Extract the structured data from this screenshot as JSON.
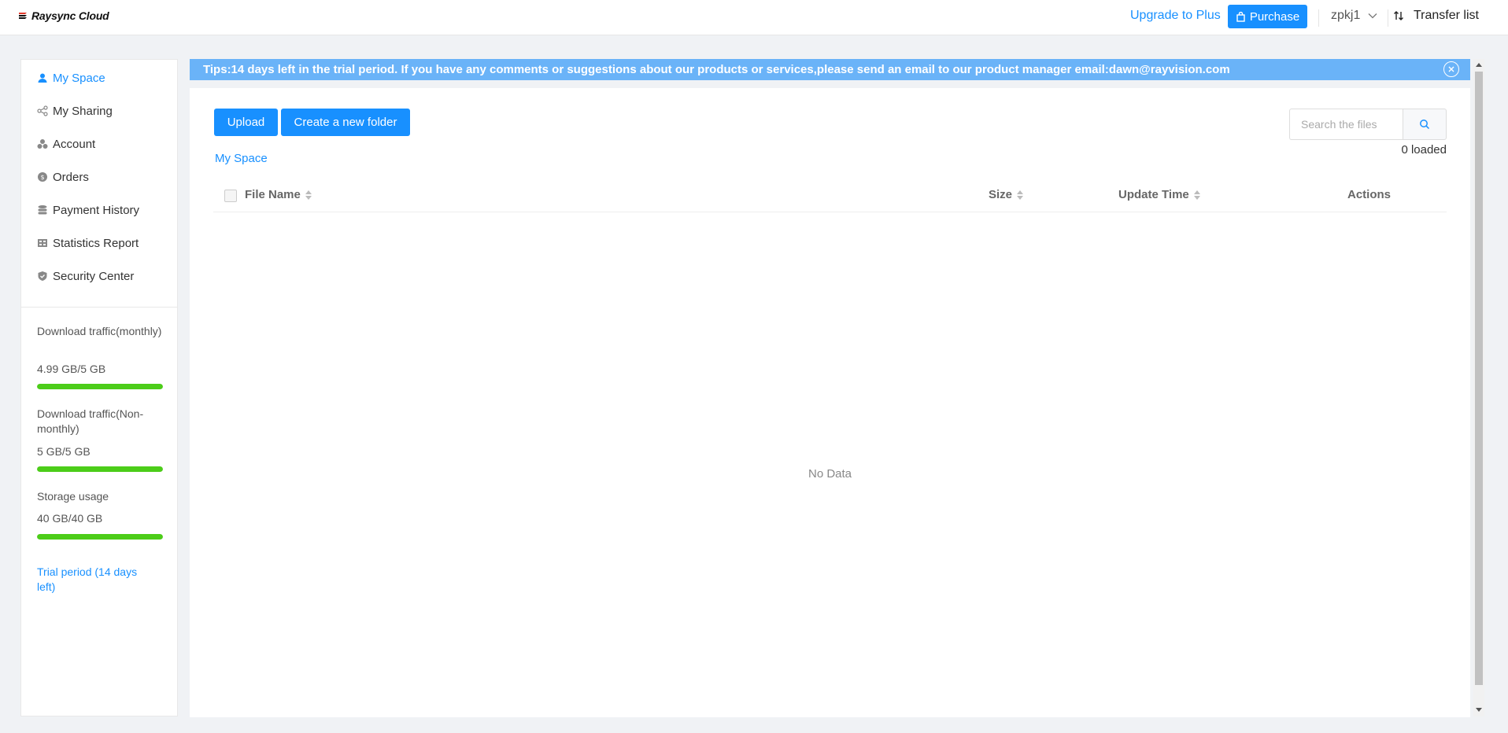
{
  "app": {
    "name": "Raysync Cloud",
    "brand_color": "#1890ff",
    "success_color": "#4ccd19"
  },
  "header": {
    "upgrade_label": "Upgrade to Plus",
    "purchase_label": "Purchase",
    "username": "zpkj1",
    "transfer_label": "Transfer list"
  },
  "sidebar": {
    "items": [
      {
        "label": "My Space",
        "icon": "user-icon",
        "active": true
      },
      {
        "label": "My Sharing",
        "icon": "share-icon"
      },
      {
        "label": "Account",
        "icon": "account-icon"
      },
      {
        "label": "Orders",
        "icon": "orders-icon"
      },
      {
        "label": "Payment History",
        "icon": "payment-icon"
      },
      {
        "label": "Statistics Report",
        "icon": "report-icon"
      },
      {
        "label": "Security Center",
        "icon": "shield-icon"
      }
    ],
    "metrics": [
      {
        "label": "Download traffic(monthly)",
        "value": "4.99 GB/5 GB",
        "fraction": 0.998
      },
      {
        "label": "Download traffic(Non-monthly)",
        "value": "5 GB/5 GB",
        "fraction": 1.0
      },
      {
        "label": "Storage usage",
        "value": "40 GB/40 GB",
        "fraction": 1.0
      }
    ],
    "trial_label": "Trial period (14 days left)"
  },
  "tips": {
    "text": "Tips:14 days left in the trial period. If you have any comments or suggestions about our products or services,please send an email to our product manager email:dawn@rayvision.com"
  },
  "main": {
    "upload_label": "Upload",
    "new_folder_label": "Create a new folder",
    "search_placeholder": "Search the files",
    "loaded_text": "0 loaded",
    "breadcrumb": "My Space",
    "columns": {
      "name": "File Name",
      "size": "Size",
      "update_time": "Update Time",
      "actions": "Actions"
    },
    "empty_text": "No Data"
  }
}
